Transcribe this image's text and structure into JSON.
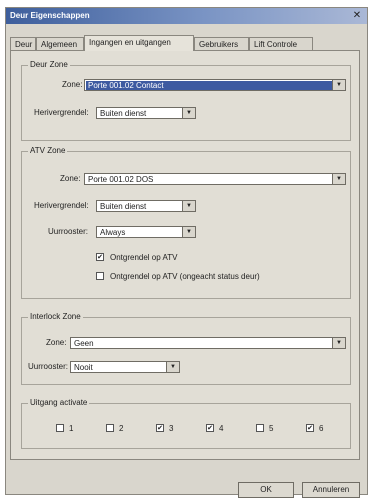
{
  "window": {
    "title": "Deur Eigenschappen",
    "close_symbol": "✕"
  },
  "tabs": [
    "Deur",
    "Algemeen",
    "Ingangen en uitgangen",
    "Gebruikers",
    "Lift Controle"
  ],
  "door_zone": {
    "legend": "Deur Zone",
    "zone_label": "Zone:",
    "zone_value": "Porte 001.02 Contact",
    "relock_label": "Herivergrendel:",
    "relock_value": "Buiten dienst"
  },
  "atv_zone": {
    "legend": "ATV Zone",
    "zone_label": "Zone:",
    "zone_value": "Porte 001.02 DOS",
    "relock_label": "Herivergrendel:",
    "relock_value": "Buiten dienst",
    "schedule_label": "Uurrooster:",
    "schedule_value": "Always",
    "unlock_atv_label": "Ontgrendel op ATV",
    "unlock_atv_checked": true,
    "unlock_atv_ignore_label": "Ontgrendel op ATV (ongeacht status deur)",
    "unlock_atv_ignore_checked": false
  },
  "interlock_zone": {
    "legend": "Interlock Zone",
    "zone_label": "Zone:",
    "zone_value": "Geen",
    "schedule_label": "Uurrooster:",
    "schedule_value": "Nooit"
  },
  "output_activation": {
    "legend": "Uitgang activate",
    "outputs": [
      {
        "label": "1",
        "checked": false
      },
      {
        "label": "2",
        "checked": false
      },
      {
        "label": "3",
        "checked": true
      },
      {
        "label": "4",
        "checked": true
      },
      {
        "label": "5",
        "checked": false
      },
      {
        "label": "6",
        "checked": true
      }
    ]
  },
  "buttons": {
    "ok": "OK",
    "cancel": "Annuleren"
  },
  "icons": {
    "dropdown": "▼",
    "check": "✔"
  }
}
